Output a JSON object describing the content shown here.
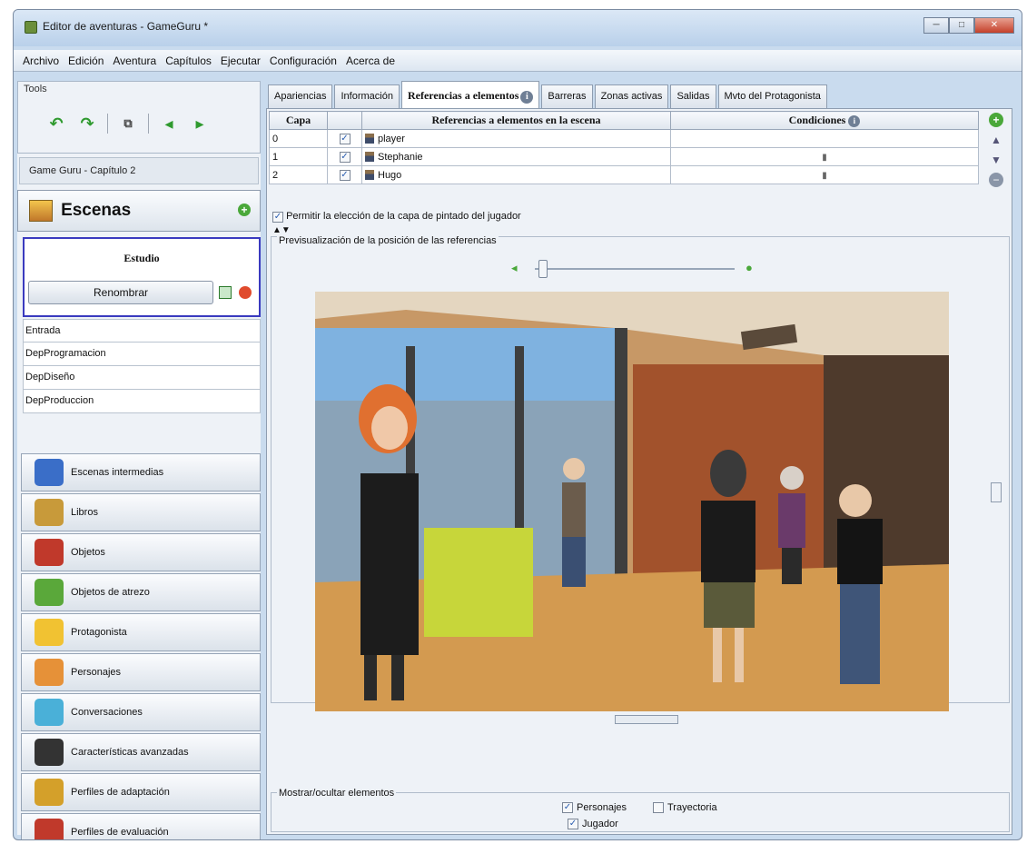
{
  "window": {
    "title": "Editor de aventuras - GameGuru *",
    "controls": [
      "minimize",
      "maximize",
      "close"
    ]
  },
  "menu": [
    "Archivo",
    "Edición",
    "Aventura",
    "Capítulos",
    "Ejecutar",
    "Configuración",
    "Acerca de"
  ],
  "tools": {
    "label": "Tools",
    "icons": [
      "undo-icon",
      "redo-icon",
      "copy-icon",
      "back-icon",
      "forward-icon"
    ]
  },
  "project_title": "Game Guru - Capítulo 2",
  "scenes": {
    "label": "Escenas",
    "selected": "Estudio",
    "rename_label": "Renombrar",
    "items": [
      "Entrada",
      "DepProgramacion",
      "DepDiseño",
      "DepProduccion"
    ]
  },
  "categories": [
    {
      "label": "Escenas intermedias",
      "icon": "cutscene-icon",
      "color": "#3a6ec8"
    },
    {
      "label": "Libros",
      "icon": "books-icon",
      "color": "#c89a3a"
    },
    {
      "label": "Objetos",
      "icon": "objects-icon",
      "color": "#c0392b"
    },
    {
      "label": "Objetos de atrezo",
      "icon": "atrezzo-icon",
      "color": "#5aa83a"
    },
    {
      "label": "Protagonista",
      "icon": "player-icon",
      "color": "#f1c232"
    },
    {
      "label": "Personajes",
      "icon": "characters-icon",
      "color": "#e69138"
    },
    {
      "label": "Conversaciones",
      "icon": "conversations-icon",
      "color": "#4ab0d8"
    },
    {
      "label": "Características avanzadas",
      "icon": "advanced-icon",
      "color": "#333333"
    },
    {
      "label": "Perfiles de adaptación",
      "icon": "adaptation-icon",
      "color": "#d4a02a"
    },
    {
      "label": "Perfiles de evaluación",
      "icon": "evaluation-icon",
      "color": "#c0392b"
    }
  ],
  "tabs": [
    "Apariencias",
    "Información",
    "Referencias a elementos",
    "Barreras",
    "Zonas activas",
    "Salidas",
    "Mvto del Protagonista"
  ],
  "active_tab": "Referencias a elementos",
  "table": {
    "headers": [
      "Capa",
      "",
      "Referencias a elementos en la escena",
      "Condiciones"
    ],
    "rows": [
      {
        "capa": "0",
        "name": "player"
      },
      {
        "capa": "1",
        "name": "Stephanie"
      },
      {
        "capa": "2",
        "name": "Hugo"
      }
    ]
  },
  "permit_label": "Permitir la elección de la capa de pintado del jugador",
  "preview": {
    "legend": "Previsualización de la posición de las referencias"
  },
  "show_hide": {
    "legend": "Mostrar/ocultar elementos",
    "personajes": "Personajes",
    "trayectoria": "Trayectoria",
    "jugador": "Jugador"
  }
}
